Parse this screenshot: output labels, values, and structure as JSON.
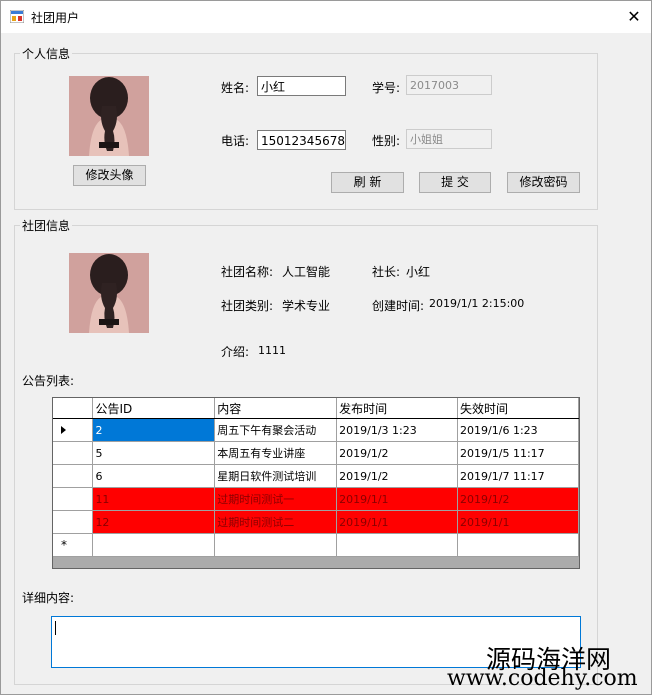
{
  "window": {
    "title": "社团用户"
  },
  "personal": {
    "group_title": "个人信息",
    "name_label": "姓名:",
    "name_value": "小红",
    "student_id_label": "学号:",
    "student_id_value": "2017003",
    "phone_label": "电话:",
    "phone_value": "15012345678",
    "gender_label": "性别:",
    "gender_value": "小姐姐",
    "change_avatar_label": "修改头像",
    "refresh_label": "刷  新",
    "submit_label": "提  交",
    "change_password_label": "修改密码"
  },
  "club": {
    "group_title": "社团信息",
    "name_label": "社团名称:",
    "name_value": "人工智能",
    "leader_label": "社长:",
    "leader_value": "小红",
    "type_label": "社团类别:",
    "type_value": "学术专业",
    "created_label": "创建时间:",
    "created_value": "2019/1/1 2:15:00",
    "intro_label": "介绍:",
    "intro_value": "1111",
    "announce_list_label": "公告列表:",
    "detail_label": "详细内容:"
  },
  "grid": {
    "columns": [
      "公告ID",
      "内容",
      "发布时间",
      "失效时间"
    ],
    "rows": [
      {
        "id": "2",
        "content": "周五下午有聚会活动",
        "publish": "2019/1/3 1:23",
        "expire": "2019/1/6 1:23",
        "expired": false,
        "selected": true
      },
      {
        "id": "5",
        "content": "本周五有专业讲座",
        "publish": "2019/1/2",
        "expire": "2019/1/5 11:17",
        "expired": false,
        "selected": false
      },
      {
        "id": "6",
        "content": "星期日软件测试培训",
        "publish": "2019/1/2",
        "expire": "2019/1/7 11:17",
        "expired": false,
        "selected": false
      },
      {
        "id": "11",
        "content": "过期时间测试一",
        "publish": "2019/1/1",
        "expire": "2019/1/2",
        "expired": true,
        "selected": false
      },
      {
        "id": "12",
        "content": "过期时间测试二",
        "publish": "2019/1/1",
        "expire": "2019/1/1",
        "expired": true,
        "selected": false
      }
    ],
    "new_row_marker": "*"
  },
  "watermark": {
    "line1": "源码海洋网",
    "line2": "www.codehy.com"
  },
  "colors": {
    "expired_row": "#ff0000",
    "selection": "#0078d7"
  }
}
